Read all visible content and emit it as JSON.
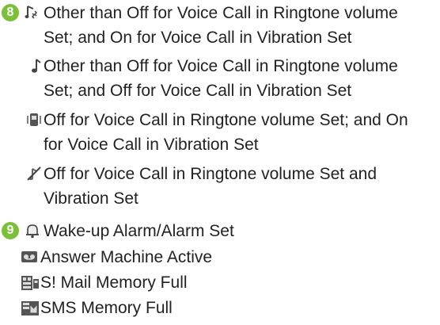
{
  "items": {
    "n8": "8",
    "n9": "9",
    "i1_line1": "Other than Off for Voice Call in Ringtone volume",
    "i1_line2": "Set; and On for Voice Call in Vibration Set",
    "i2_line1": "Other than Off for Voice Call in Ringtone volume",
    "i2_line2": "Set; and Off for Voice Call in Vibration Set",
    "i3_line1": "Off for Voice Call in Ringtone volume Set; and On",
    "i3_line2": "for Voice Call in Vibration Set",
    "i4_line1": "Off for Voice Call in Ringtone volume Set and",
    "i4_line2": "Vibration Set",
    "i5": "Wake-up Alarm/Alarm Set",
    "i6": "Answer Machine Active",
    "i7": "S! Mail Memory Full",
    "i8": "SMS Memory Full"
  },
  "icons": {
    "i1": "ring-vibrate-icon",
    "i2": "music-note-icon",
    "i3": "vibrate-phone-icon",
    "i4": "silent-muted-icon",
    "i5": "alarm-bell-icon",
    "i6": "answer-machine-icon",
    "i7": "mail-full-icon",
    "i8": "sms-full-icon"
  },
  "colors": {
    "badge": "#7cc03a",
    "text": "#222222"
  }
}
